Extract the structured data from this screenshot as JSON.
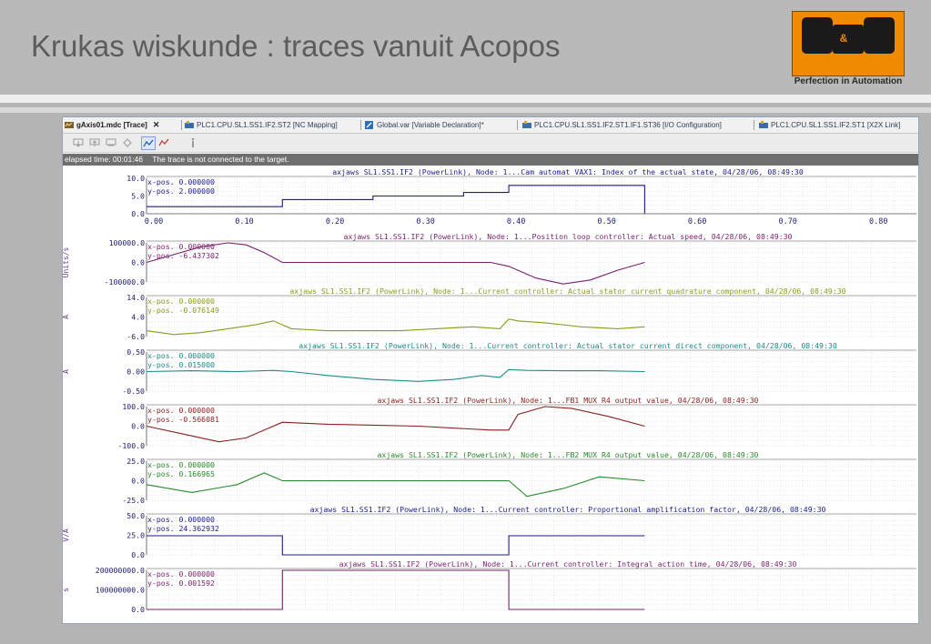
{
  "slide": {
    "title": "Krukas wiskunde : traces vanuit Acopos",
    "logo_tagline": "Perfection in Automation",
    "logo_letters": "B&R"
  },
  "tabs": [
    {
      "label": "gAxis01.mdc [Trace]",
      "active": true,
      "icon": "trace-icon"
    },
    {
      "label": "PLC1.CPU.SL1.SS1.IF2.ST2 [NC Mapping]",
      "active": false,
      "icon": "plc-icon"
    },
    {
      "label": "Global.var [Variable Declaration]*",
      "active": false,
      "icon": "variable-icon"
    },
    {
      "label": "PLC1.CPU.SL1.SS1.IF2.ST1.IF1.ST36 [I/O Configuration]",
      "active": false,
      "icon": "plc-icon"
    },
    {
      "label": "PLC1.CPU.SL1.SS1.IF2.ST1 [X2X Link]",
      "active": false,
      "icon": "plc-icon"
    }
  ],
  "tab_close": "✕",
  "status": {
    "elapsed": "elapsed time: 00:01:46",
    "message": "The trace is not connected to the target."
  },
  "x_axis": {
    "ticks": [
      "0.00",
      "0.10",
      "0.20",
      "0.30",
      "0.40",
      "0.50",
      "0.60",
      "0.70",
      "0.80"
    ],
    "range": [
      0,
      0.85
    ]
  },
  "chart_data": [
    {
      "type": "line",
      "title": "axjaws SL1.SS1.IF2 (PowerLink), Node: 1...Cam automat VAX1: Index of the actual state, 04/28/06, 08:49:30",
      "ylabel": "",
      "ylim": [
        0,
        10
      ],
      "yticks": [
        "10.0",
        "5.0",
        "0.0"
      ],
      "ytick_values": [
        10,
        5,
        0
      ],
      "xpos": "x-pos.   0.000000",
      "ypos": "y-pos.   2.000000",
      "color": "#1c1c8c",
      "series": [
        {
          "x": [
            0,
            0.15,
            0.15,
            0.25,
            0.25,
            0.35,
            0.35,
            0.4,
            0.4,
            0.55,
            0.55
          ],
          "y": [
            2,
            2,
            4,
            4,
            5,
            5,
            6,
            6,
            8,
            8,
            0
          ]
        }
      ]
    },
    {
      "type": "line",
      "title": "axjaws SL1.SS1.IF2 (PowerLink), Node: 1...Position loop controller: Actual speed, 04/28/06, 08:49:30",
      "ylabel": "Units/s",
      "ylim": [
        -100000,
        100000
      ],
      "yticks": [
        "100000.0",
        "0.0",
        "-100000.0"
      ],
      "ytick_values": [
        100000,
        0,
        -100000
      ],
      "xpos": "x-pos.   0.000000",
      "ypos": "y-pos.   -6.437302",
      "color": "#7a1f6e",
      "series": [
        {
          "x": [
            0,
            0.03,
            0.06,
            0.09,
            0.11,
            0.13,
            0.15,
            0.2,
            0.3,
            0.38,
            0.4,
            0.43,
            0.46,
            0.49,
            0.52,
            0.55
          ],
          "y": [
            0,
            40000,
            80000,
            100000,
            90000,
            50000,
            0,
            0,
            0,
            0,
            -20000,
            -80000,
            -110000,
            -90000,
            -40000,
            0
          ]
        }
      ]
    },
    {
      "type": "line",
      "title": "axjaws SL1.SS1.IF2 (PowerLink), Node: 1...Current controller: Actual stator current quadrature component, 04/28/06, 08:49:30",
      "ylabel": "A",
      "ylim": [
        -6,
        14
      ],
      "yticks": [
        "14.0",
        "4.0",
        "-6.0"
      ],
      "ytick_values": [
        14,
        4,
        -6
      ],
      "xpos": "x-pos.   0.000000",
      "ypos": "y-pos.   -0.076149",
      "color": "#8e9a1c",
      "series": [
        {
          "x": [
            0,
            0.03,
            0.06,
            0.09,
            0.12,
            0.14,
            0.16,
            0.2,
            0.28,
            0.36,
            0.39,
            0.4,
            0.41,
            0.44,
            0.48,
            0.52,
            0.55
          ],
          "y": [
            -3,
            -5,
            -4,
            -2,
            0,
            2,
            -2,
            -3,
            -3,
            -1,
            -2,
            3,
            2,
            1,
            -1,
            -2,
            -1
          ]
        }
      ]
    },
    {
      "type": "line",
      "title": "axjaws SL1.SS1.IF2 (PowerLink), Node: 1...Current controller: Actual stator current direct component, 04/28/06, 08:49:30",
      "ylabel": "A",
      "ylim": [
        -0.5,
        0.5
      ],
      "yticks": [
        "0.50",
        "0.00",
        "-0.50"
      ],
      "ytick_values": [
        0.5,
        0,
        -0.5
      ],
      "xpos": "x-pos.   0.000000",
      "ypos": "y-pos.   0.015000",
      "color": "#1f8a8a",
      "series": [
        {
          "x": [
            0,
            0.05,
            0.1,
            0.14,
            0.16,
            0.2,
            0.25,
            0.3,
            0.34,
            0.37,
            0.39,
            0.4,
            0.42,
            0.46,
            0.5,
            0.55
          ],
          "y": [
            0,
            0.02,
            0,
            0.03,
            0,
            -0.1,
            -0.2,
            -0.25,
            -0.2,
            -0.1,
            -0.15,
            0.05,
            0.03,
            0.02,
            0.02,
            0
          ]
        }
      ]
    },
    {
      "type": "line",
      "title": "axjaws SL1.SS1.IF2 (PowerLink), Node: 1...FB1 MUX R4 output value, 04/28/06, 08:49:30",
      "ylabel": "",
      "ylim": [
        -100,
        100
      ],
      "yticks": [
        "100.0",
        "0.0",
        "-100.0"
      ],
      "ytick_values": [
        100,
        0,
        -100
      ],
      "xpos": "x-pos.   0.000000",
      "ypos": "y-pos.   -0.566081",
      "color": "#8a1f1f",
      "series": [
        {
          "x": [
            0,
            0.04,
            0.08,
            0.11,
            0.13,
            0.15,
            0.2,
            0.3,
            0.38,
            0.4,
            0.41,
            0.44,
            0.47,
            0.51,
            0.55
          ],
          "y": [
            0,
            -40,
            -80,
            -60,
            -20,
            20,
            10,
            0,
            -20,
            -20,
            60,
            100,
            90,
            50,
            0
          ]
        }
      ]
    },
    {
      "type": "line",
      "title": "axjaws SL1.SS1.IF2 (PowerLink), Node: 1...FB2 MUX R4 output value, 04/28/06, 08:49:30",
      "ylabel": "",
      "ylim": [
        -25,
        25
      ],
      "yticks": [
        "25.0",
        "0.0",
        "-25.0"
      ],
      "ytick_values": [
        25,
        0,
        -25
      ],
      "xpos": "x-pos.   0.000000",
      "ypos": "y-pos.   0.166965",
      "color": "#2a8a2a",
      "series": [
        {
          "x": [
            0,
            0.05,
            0.1,
            0.13,
            0.14,
            0.15,
            0.2,
            0.3,
            0.4,
            0.42,
            0.46,
            0.5,
            0.55
          ],
          "y": [
            -5,
            -15,
            -5,
            10,
            5,
            0,
            0,
            0,
            0,
            -20,
            -10,
            5,
            0
          ]
        }
      ]
    },
    {
      "type": "line",
      "title": "axjaws SL1.SS1.IF2 (PowerLink), Node: 1...Current controller: Proportional amplification factor, 04/28/06, 08:49:30",
      "ylabel": "V/A",
      "ylim": [
        0,
        50
      ],
      "yticks": [
        "50.0",
        "25.0",
        "0.0"
      ],
      "ytick_values": [
        50,
        25,
        0
      ],
      "xpos": "x-pos.   0.000000",
      "ypos": "y-pos.   24.362932",
      "color": "#1c1c8c",
      "series": [
        {
          "x": [
            0,
            0.15,
            0.15,
            0.4,
            0.4,
            0.55
          ],
          "y": [
            24.4,
            24.4,
            0,
            0,
            24.4,
            24.4
          ]
        }
      ]
    },
    {
      "type": "line",
      "title": "axjaws SL1.SS1.IF2 (PowerLink), Node: 1...Current controller: Integral action time, 04/28/06, 08:49:30",
      "ylabel": "s",
      "ylim": [
        0,
        200000000
      ],
      "yticks": [
        "200000000.0",
        "100000000.0",
        "0.0"
      ],
      "ytick_values": [
        200000000,
        100000000,
        0
      ],
      "xpos": "x-pos.   0.000000",
      "ypos": "y-pos.   0.001592",
      "color": "#7a1f6e",
      "series": [
        {
          "x": [
            0,
            0.15,
            0.15,
            0.4,
            0.4,
            0.55
          ],
          "y": [
            0,
            0,
            200000000,
            200000000,
            0,
            0
          ]
        }
      ]
    }
  ]
}
